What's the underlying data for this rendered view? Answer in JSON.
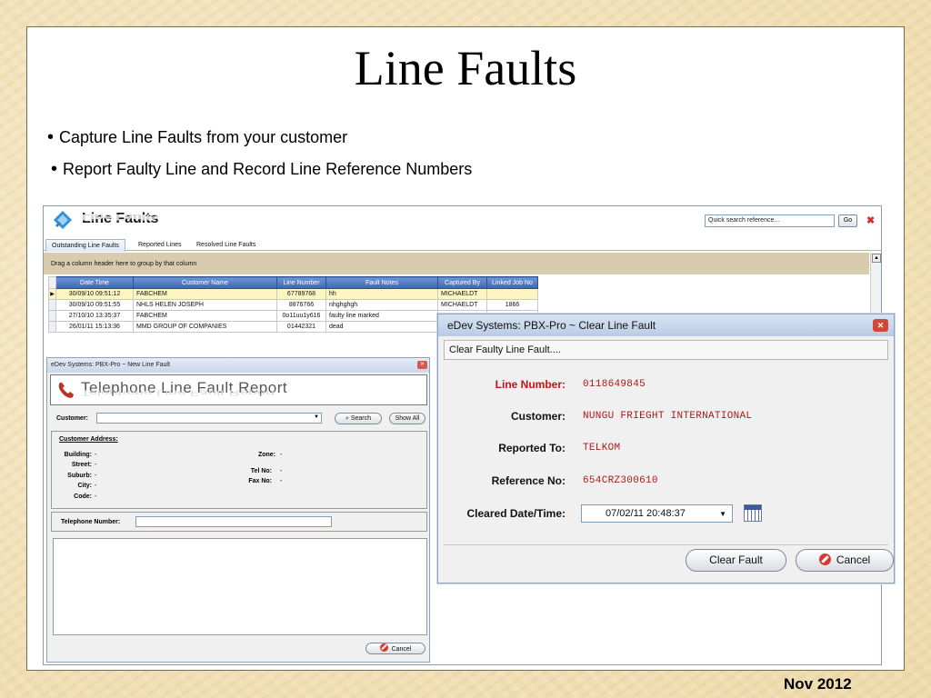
{
  "slide": {
    "title": "Line Faults",
    "bullets": [
      "Capture Line Faults from your customer",
      "Report Faulty Line and Record Line Reference Numbers"
    ],
    "footer_date": "Nov 2012"
  },
  "app": {
    "title": "Line Faults",
    "quick_search_placeholder": "Quick search reference...",
    "go_label": "Go",
    "tabs": [
      "Outstanding Line Faults",
      "Reported Lines",
      "Resolved Line Faults"
    ],
    "group_hint": "Drag a column header here to group by that column",
    "grid": {
      "columns": [
        "Date Time",
        "Customer Name",
        "Line Number",
        "Fault Notes",
        "Captured By",
        "Linked Job No"
      ],
      "rows": [
        [
          "30/09/10 09:51:12",
          "FABCHEM",
          "67789768",
          "hh",
          "MICHAELDT",
          ""
        ],
        [
          "30/09/10 09:51:55",
          "NHLS HELEN JOSEPH",
          "8876766",
          "nhghghgh",
          "MICHAELDT",
          "1866"
        ],
        [
          "27/10/10 13:35:37",
          "FABCHEM",
          "0o11uu1y616",
          "faulty line marked",
          "",
          ""
        ],
        [
          "26/01/11 15:13:36",
          "MMD GROUP OF COMPANIES",
          "01442321",
          "dead",
          "",
          ""
        ]
      ]
    }
  },
  "new_fault_dialog": {
    "window_title": "eDev Systems: PBX-Pro ~ New Line Fault",
    "heading": "Telephone Line Fault Report",
    "customer_label": "Customer:",
    "search_label": "Search",
    "show_all_label": "Show All",
    "address_heading": "Customer Address:",
    "address": [
      {
        "label": "Building:",
        "value": "-"
      },
      {
        "label": "Street:",
        "value": "-"
      },
      {
        "label": "Suburb:",
        "value": "-"
      },
      {
        "label": "City:",
        "value": "-"
      },
      {
        "label": "Code:",
        "value": "-"
      }
    ],
    "zone_label": "Zone:",
    "zone_value": "-",
    "tel_no_label": "Tel No:",
    "tel_no_value": "-",
    "fax_no_label": "Fax No:",
    "fax_no_value": "-",
    "telephone_number_label": "Telephone Number:",
    "cancel_label": "Cancel"
  },
  "clear_fault_dialog": {
    "window_title": "eDev Systems: PBX-Pro ~ Clear Line Fault",
    "subtitle": "Clear Faulty Line Fault....",
    "fields": [
      {
        "label": "Line Number:",
        "value": "0118649845"
      },
      {
        "label": "Customer:",
        "value": "NUNGU FRIEGHT INTERNATIONAL"
      },
      {
        "label": "Reported To:",
        "value": "TELKOM"
      },
      {
        "label": "Reference No:",
        "value": "654CRZ300610"
      }
    ],
    "cleared_label": "Cleared Date/Time:",
    "cleared_value": "07/02/11 20:48:37",
    "clear_button": "Clear Fault",
    "cancel_button": "Cancel"
  },
  "colors": {
    "grid_header": "#3d66b4",
    "selected_row": "#fdf6c3",
    "field_value": "#aa1a1a",
    "required_label": "#cc1111"
  }
}
